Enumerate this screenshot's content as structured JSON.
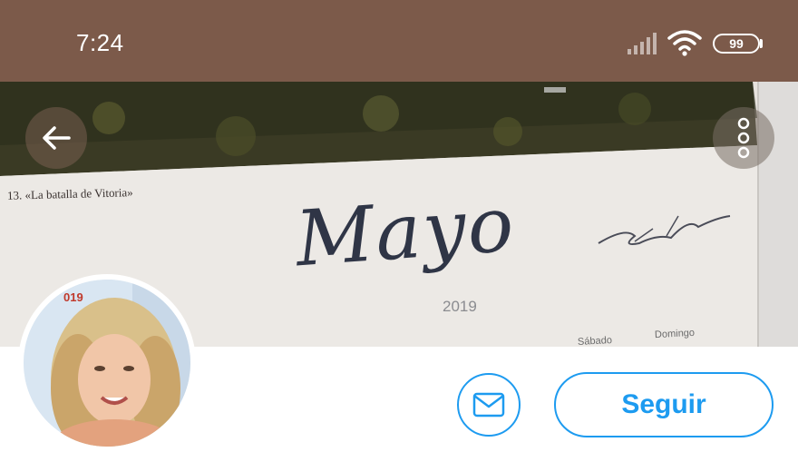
{
  "status_bar": {
    "time": "7:24",
    "battery_level": "99",
    "icons": [
      "signal-icon",
      "wifi-icon",
      "battery-icon"
    ],
    "background_color": "#7c5a4a"
  },
  "header": {
    "back_icon": "arrow-left-icon",
    "more_icon": "more-vertical-icon",
    "photo": {
      "caption": "13. «La batalla de Vitoria»",
      "month": "Mayo",
      "year": "2019",
      "day_labels": [
        "Sábado",
        "Domingo"
      ]
    }
  },
  "profile": {
    "avatar_corner_text": "019",
    "message_icon": "mail-icon",
    "follow_label": "Seguir",
    "accent_color": "#1d9bf0"
  }
}
